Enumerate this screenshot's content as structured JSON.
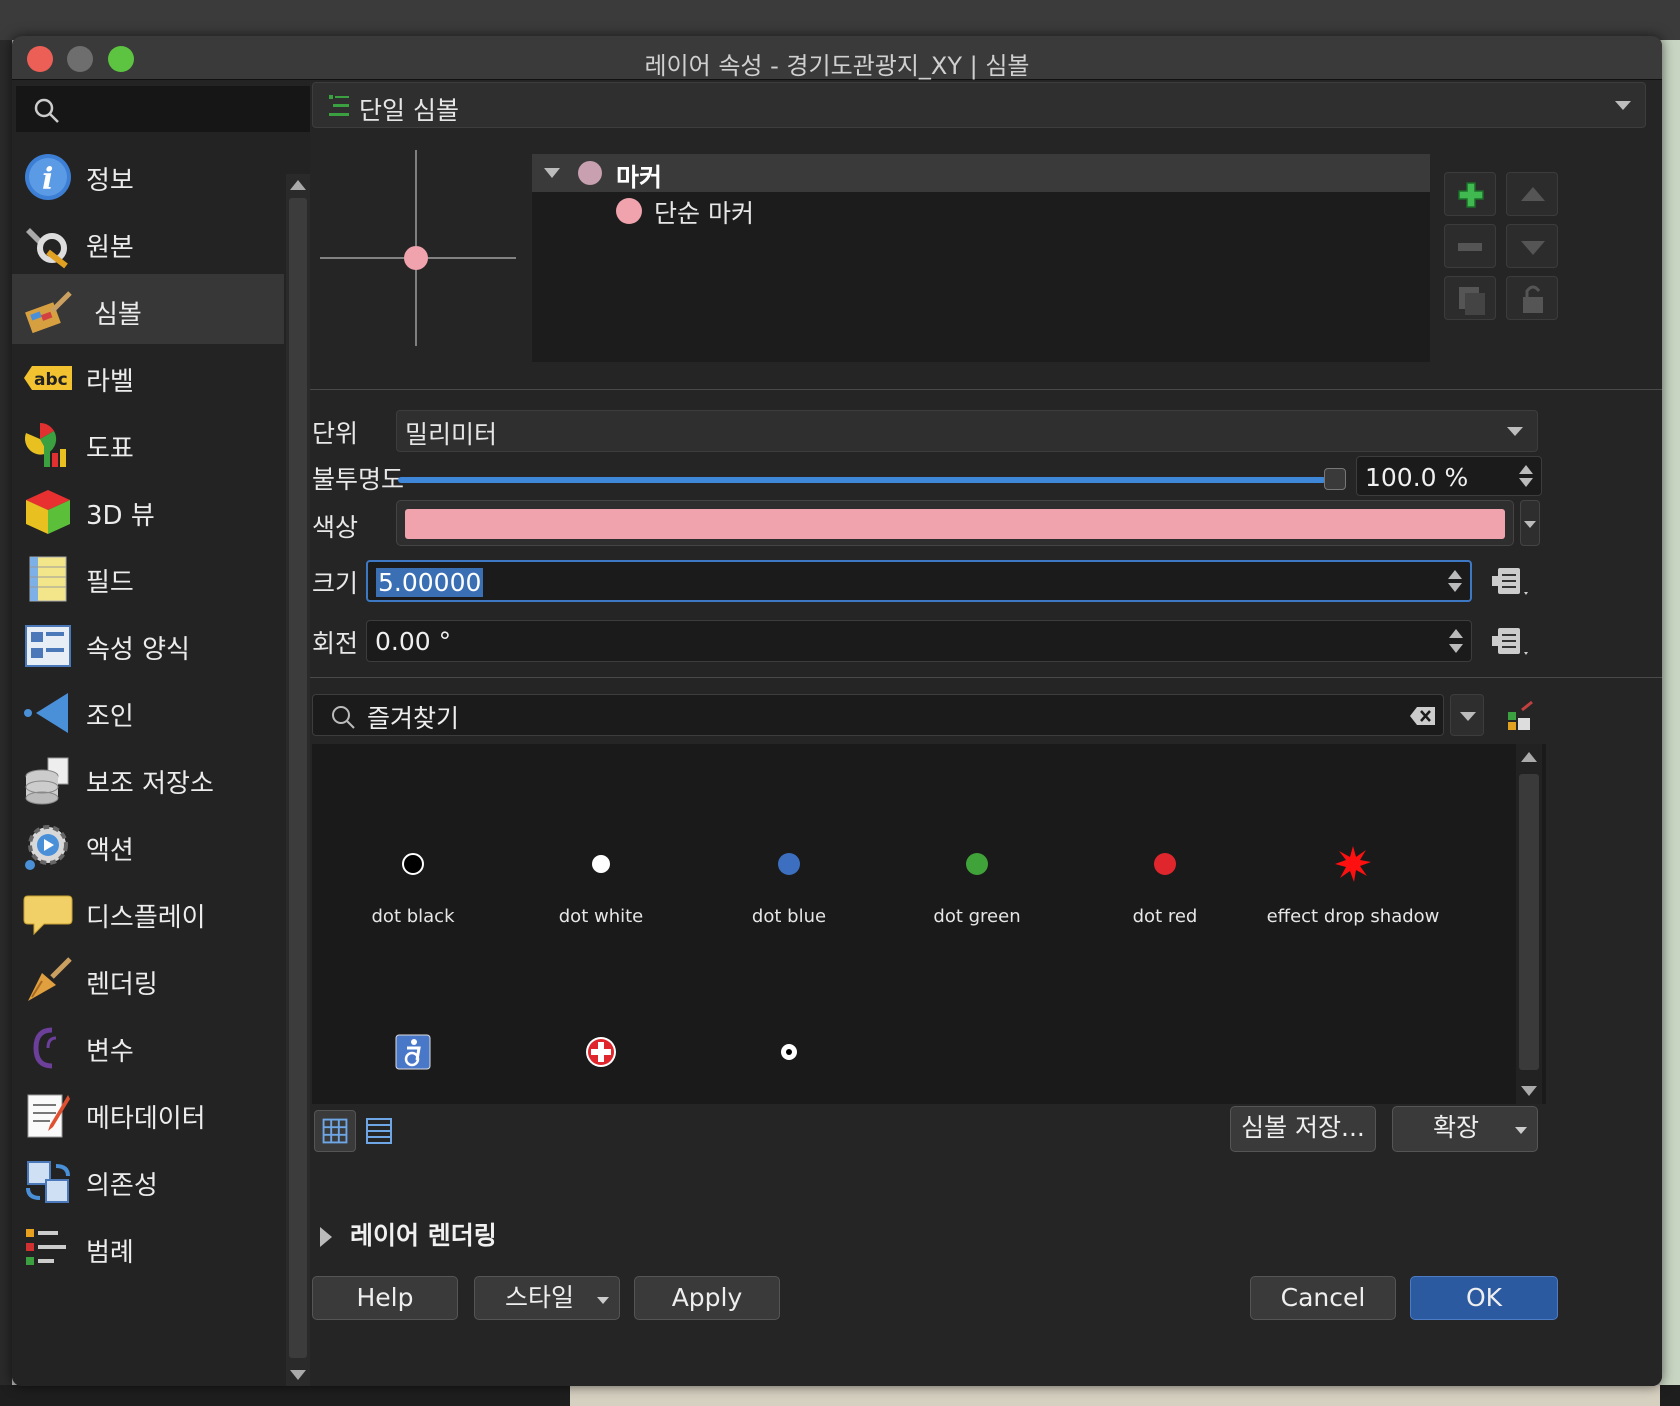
{
  "window": {
    "title": "레이어 속성 - 경기도관광지_XY | 심볼"
  },
  "sidebar": {
    "search_placeholder": "",
    "items": [
      {
        "label": "정보",
        "icon": "info-icon"
      },
      {
        "label": "원본",
        "icon": "source-icon"
      },
      {
        "label": "심볼",
        "icon": "symbology-icon",
        "active": true
      },
      {
        "label": "라벨",
        "icon": "labels-icon"
      },
      {
        "label": "도표",
        "icon": "diagrams-icon"
      },
      {
        "label": "3D 뷰",
        "icon": "3d-view-icon"
      },
      {
        "label": "필드",
        "icon": "fields-icon"
      },
      {
        "label": "속성 양식",
        "icon": "attributes-form-icon"
      },
      {
        "label": "조인",
        "icon": "joins-icon"
      },
      {
        "label": "보조 저장소",
        "icon": "auxiliary-storage-icon"
      },
      {
        "label": "액션",
        "icon": "actions-icon"
      },
      {
        "label": "디스플레이",
        "icon": "display-icon"
      },
      {
        "label": "렌더링",
        "icon": "rendering-icon"
      },
      {
        "label": "변수",
        "icon": "variables-icon"
      },
      {
        "label": "메타데이터",
        "icon": "metadata-icon"
      },
      {
        "label": "의존성",
        "icon": "dependencies-icon"
      },
      {
        "label": "범례",
        "icon": "legend-icon"
      }
    ]
  },
  "renderer": {
    "label": "단일 심볼"
  },
  "symbol_tree": {
    "root": "마커",
    "child": "단순 마커"
  },
  "fields": {
    "unit_label": "단위",
    "unit_value": "밀리미터",
    "opacity_label": "불투명도",
    "opacity_value": "100.0 %",
    "opacity_fraction": 1.0,
    "color_label": "색상",
    "color_value": "#f0a2ad",
    "size_label": "크기",
    "size_value": "5.00000",
    "rotation_label": "회전",
    "rotation_value": "0.00 °"
  },
  "favorites": {
    "search_text": "즐겨찾기",
    "symbols": [
      {
        "name": "dot  black",
        "color": "#000000"
      },
      {
        "name": "dot  white",
        "color": "#ffffff"
      },
      {
        "name": "dot blue",
        "color": "#3d6fc0"
      },
      {
        "name": "dot green",
        "color": "#3fa33a"
      },
      {
        "name": "dot red",
        "color": "#e0262d"
      },
      {
        "name": "effect drop shadow",
        "color": "#ff1010"
      },
      {
        "name": "",
        "icon": "accessibility-icon"
      },
      {
        "name": "",
        "icon": "first-aid-icon"
      },
      {
        "name": "",
        "icon": "small-dot-icon"
      }
    ]
  },
  "buttons": {
    "save_symbol": "심볼 저장...",
    "advanced": "확장",
    "layer_rendering": "레이어 렌더링",
    "help": "Help",
    "style": "스타일",
    "apply": "Apply",
    "cancel": "Cancel",
    "ok": "OK"
  }
}
